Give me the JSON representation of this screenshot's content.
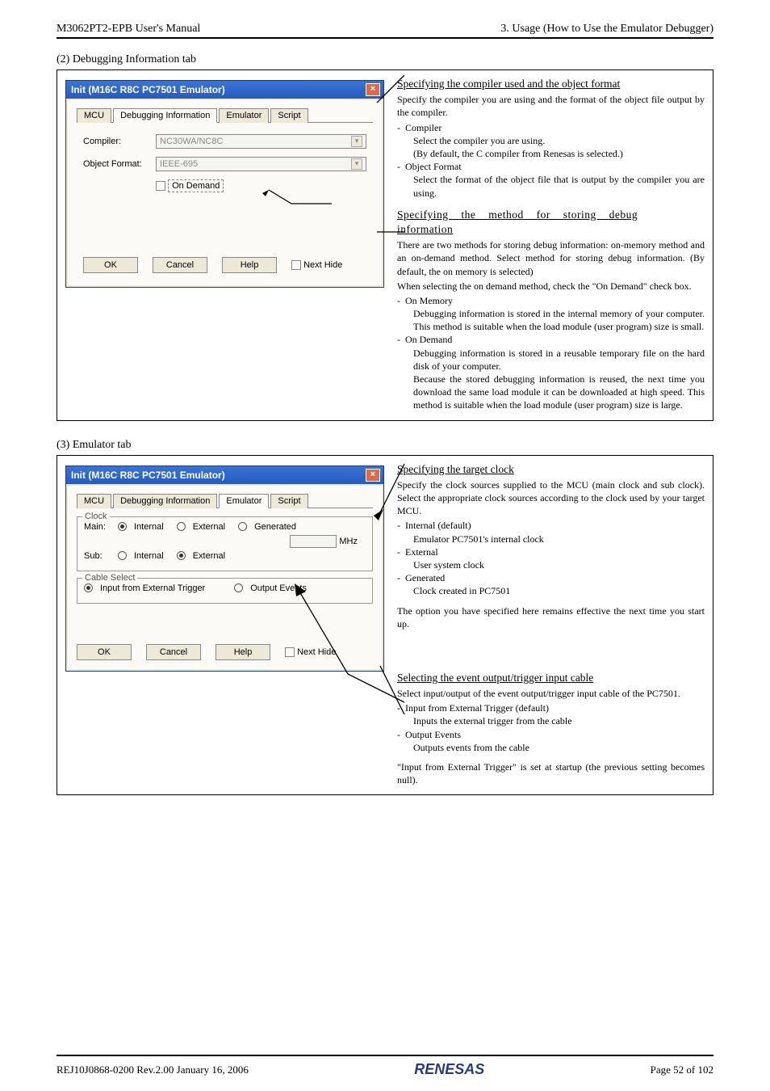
{
  "header": {
    "left": "M3062PT2-EPB User's Manual",
    "right": "3. Usage (How to Use the Emulator Debugger)"
  },
  "sections": {
    "s2": {
      "title": "(2) Debugging Information tab"
    },
    "s3": {
      "title": "(3) Emulator tab"
    }
  },
  "dialog1": {
    "title": "Init (M16C R8C PC7501 Emulator)",
    "tabs": [
      "MCU",
      "Debugging Information",
      "Emulator",
      "Script"
    ],
    "active_tab": 1,
    "compiler_label": "Compiler:",
    "compiler_value": "NC30WA/NC8C",
    "objfmt_label": "Object Format:",
    "objfmt_value": "IEEE-695",
    "ondemand_label": "On Demand",
    "buttons": {
      "ok": "OK",
      "cancel": "Cancel",
      "help": "Help",
      "nexthide": "Next Hide"
    }
  },
  "dialog2": {
    "title": "Init (M16C R8C PC7501 Emulator)",
    "tabs": [
      "MCU",
      "Debugging Information",
      "Emulator",
      "Script"
    ],
    "active_tab": 2,
    "clock_legend": "Clock",
    "main_label": "Main:",
    "sub_label": "Sub:",
    "opts": {
      "internal": "Internal",
      "external": "External",
      "generated": "Generated"
    },
    "mhz": "MHz",
    "cable_legend": "Cable Select",
    "cable_opts": {
      "input": "Input from External Trigger",
      "output": "Output Events"
    },
    "buttons": {
      "ok": "OK",
      "cancel": "Cancel",
      "help": "Help",
      "nexthide": "Next Hide"
    }
  },
  "text2": {
    "h1": "Specifying the compiler used and the object format",
    "p1": "Specify the compiler you are using and the format of the object file output by the compiler.",
    "li1": "Compiler",
    "li1a": "Select the compiler you are using.",
    "li1b": "(By default, the C compiler from Renesas is selected.)",
    "li2": "Object Format",
    "li2a": "Select the format of the object file that is output by the compiler you are using.",
    "h2": "Specifying the method for storing debug information",
    "p2": "There are two methods for storing debug information: on-memory method and an on-demand method. Select method for storing debug information. (By default, the on memory is selected)",
    "p3": "When selecting the on demand method, check the \"On Demand\" check box.",
    "li3": "On Memory",
    "li3a": "Debugging information is stored in the internal memory of your computer. This method is suitable when the load module (user program) size is small.",
    "li4": "On Demand",
    "li4a": "Debugging information is stored in a reusable temporary file on the hard disk of your computer.",
    "li4b": "Because the stored debugging information is reused, the next time you download the same load module it can be downloaded at high speed. This method is suitable when the load module (user program) size is large."
  },
  "text3": {
    "h1": "Specifying the target clock",
    "p1": "Specify the clock sources supplied to the MCU (main clock and sub clock). Select the appropriate clock sources according to the clock used by your target MCU.",
    "li1": "Internal (default)",
    "li1a": "Emulator PC7501's internal clock",
    "li2": "External",
    "li2a": "User system clock",
    "li3": "Generated",
    "li3a": "Clock created in PC7501",
    "p2": "The option you have specified here remains effective the next time you start up.",
    "h2": "Selecting the event output/trigger input cable",
    "p3": "Select input/output of the event output/trigger input cable of the PC7501.",
    "li4": "Input from External Trigger (default)",
    "li4a": "Inputs the external trigger from the cable",
    "li5": "Output Events",
    "li5a": "Outputs events from the cable",
    "p4": "\"Input from External Trigger\" is set at startup (the previous setting becomes null)."
  },
  "footer": {
    "left": "REJ10J0868-0200   Rev.2.00   January 16, 2006",
    "logo": "RENESAS",
    "right": "Page 52 of 102"
  }
}
